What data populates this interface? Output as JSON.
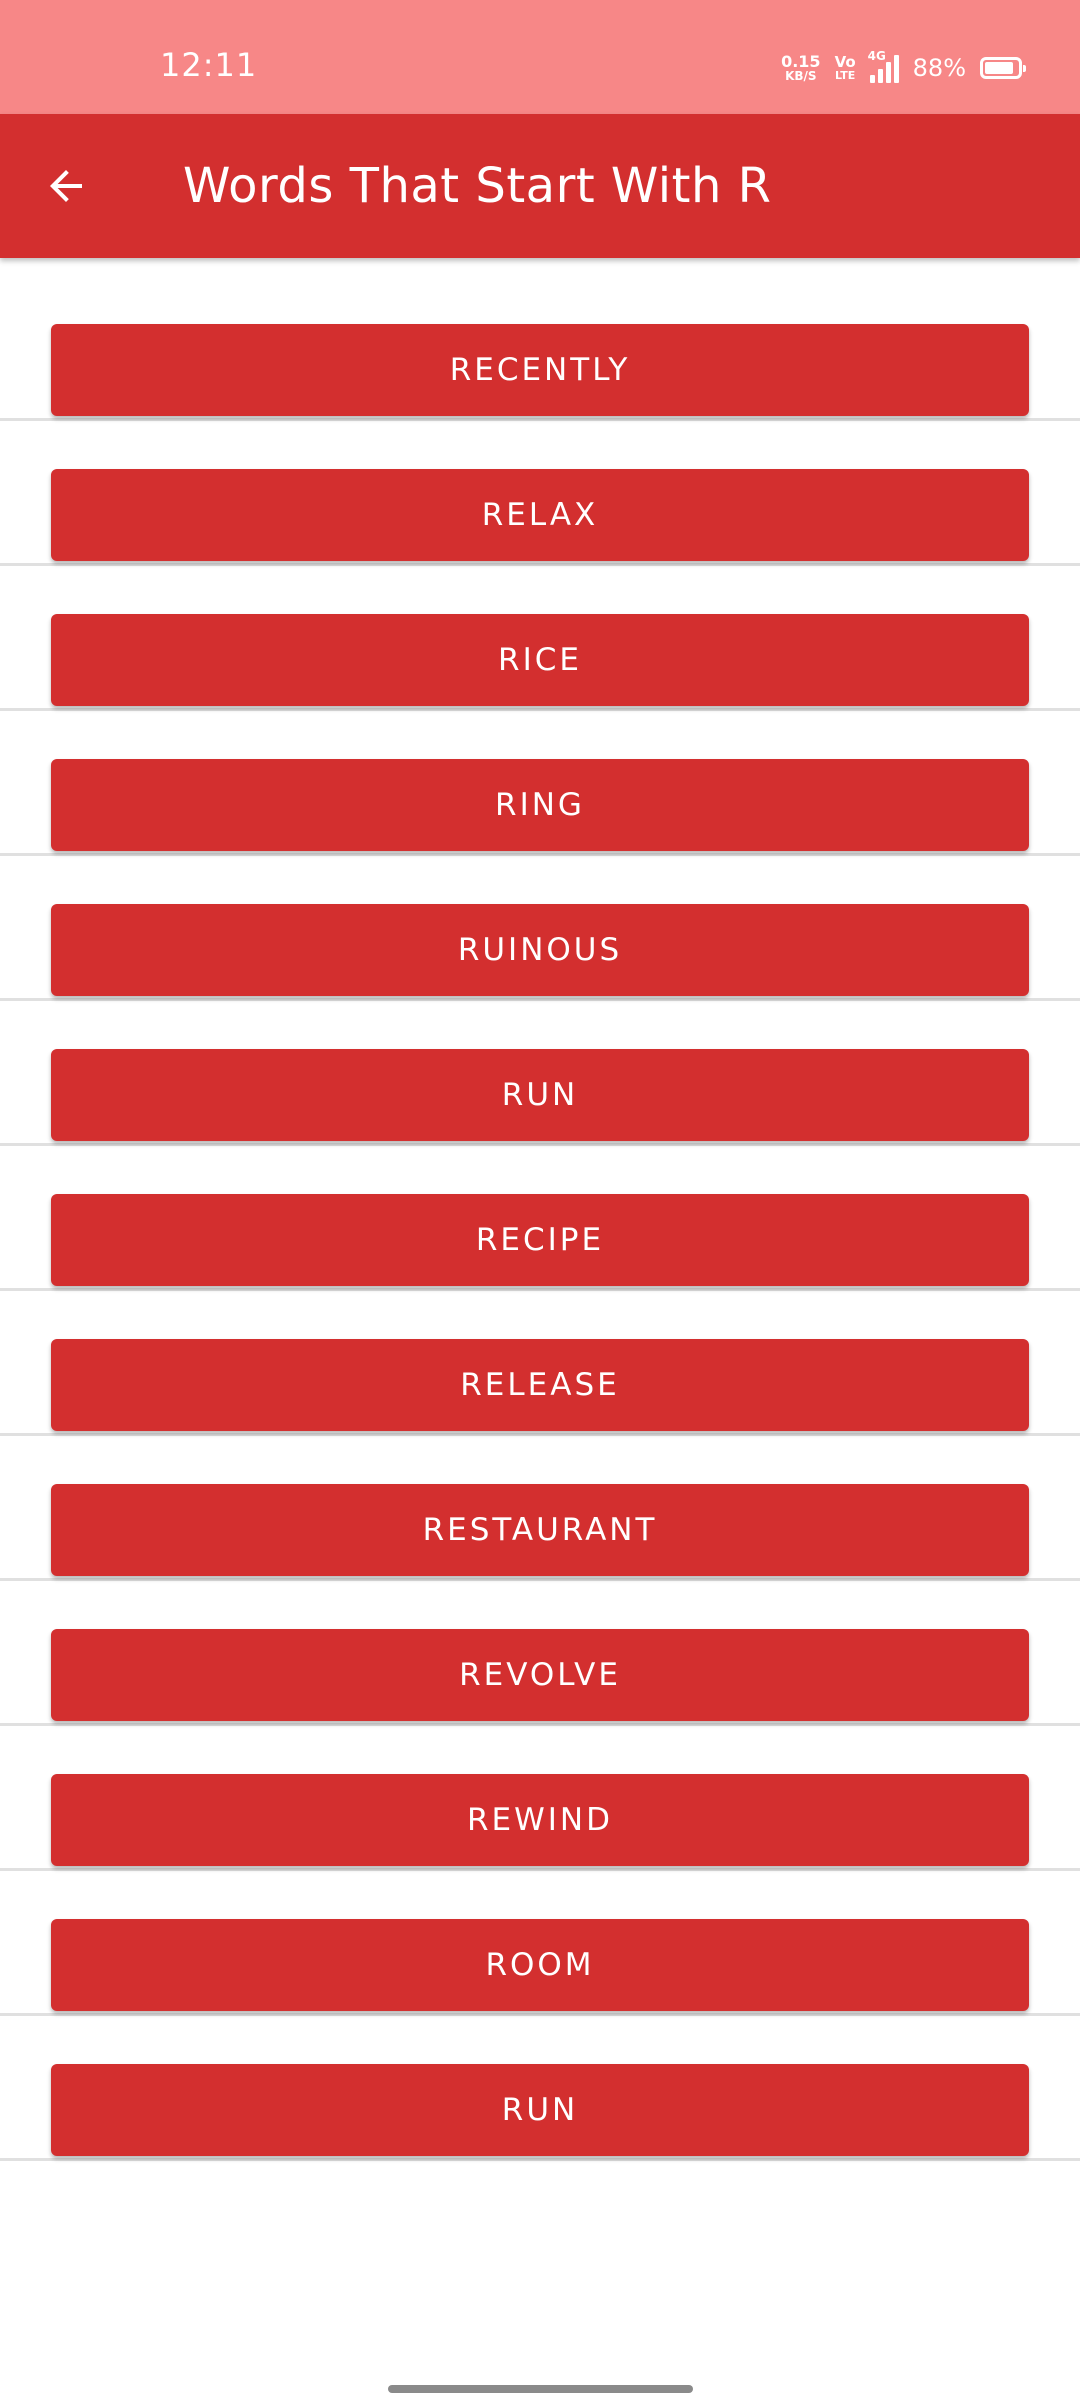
{
  "status_bar": {
    "time": "12:11",
    "net_speed_value": "0.15",
    "net_speed_unit": "KB/S",
    "volte_top": "Vo",
    "volte_bottom": "LTE",
    "network_type": "4G",
    "battery_percent": "88%",
    "battery_level": 0.88
  },
  "app_bar": {
    "back_icon": "arrow-left-icon",
    "title": "Words That Start With R",
    "color": "#d32f2f"
  },
  "status_bar_color": "#f78787",
  "words": [
    "RECENTLY",
    "RELAX",
    "RICE",
    "RING",
    "RUINOUS",
    "RUN",
    "RECIPE",
    "RELEASE",
    "RESTAURANT",
    "REVOLVE",
    "REWIND",
    "ROOM",
    "RUN"
  ]
}
